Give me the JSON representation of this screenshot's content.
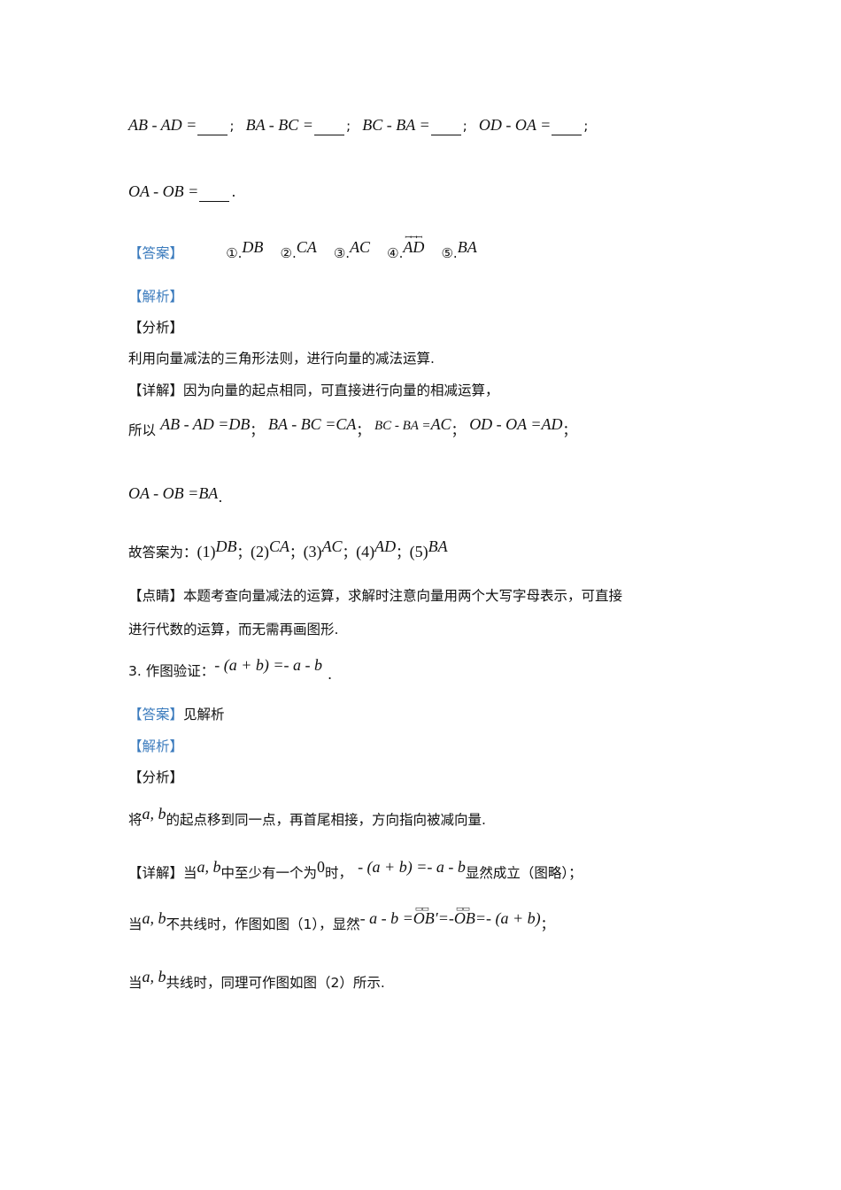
{
  "exercise_line1": [
    {
      "expr": "AB - AD =",
      "end": ";"
    },
    {
      "expr": "BA - BC =",
      "end": ";"
    },
    {
      "expr": "BC - BA =",
      "end": ";"
    },
    {
      "expr": "OD - OA =",
      "end": ";"
    }
  ],
  "exercise_line2": {
    "expr": "OA - OB =",
    "end": "."
  },
  "answer": {
    "tag": "【答案】",
    "items": [
      {
        "num": "①.",
        "val": "DB"
      },
      {
        "num": "②.",
        "val": "CA"
      },
      {
        "num": "③.",
        "val": "AC"
      },
      {
        "num": "④.",
        "val": "AD",
        "overline_mark": "ꟷ"
      },
      {
        "num": "⑤.",
        "val": "BA"
      }
    ]
  },
  "analysis_tag": "【解析】",
  "fenxi_tag": "【分析】",
  "fenxi_text": "利用向量减法的三角形法则，进行向量的减法运算.",
  "detail": {
    "tag": "【详解】",
    "text": "因为向量的起点相同，可直接进行向量的相减运算，",
    "prefix": "所以",
    "eqs": [
      {
        "lhs": "AB - AD =",
        "rhs": "DB",
        "end": "；"
      },
      {
        "lhs": "BA - BC =",
        "rhs": "CA",
        "end": "；"
      },
      {
        "lhs": "BC - BA =",
        "rhs": "AC",
        "end": "；"
      },
      {
        "lhs": "OD - OA =",
        "rhs": "AD",
        "end": "；"
      }
    ],
    "eq5": {
      "lhs": "OA - OB =",
      "rhs": "BA",
      "end": "."
    }
  },
  "summary": {
    "prefix": "故答案为：",
    "items": [
      {
        "num": "(1)",
        "val": "DB",
        "end": "；"
      },
      {
        "num": "(2)",
        "val": "CA",
        "end": "；"
      },
      {
        "num": "(3)",
        "val": "AC",
        "end": "；"
      },
      {
        "num": "(4)",
        "val": "AD",
        "end": "；"
      },
      {
        "num": "(5)",
        "val": "BA",
        "end": ""
      }
    ]
  },
  "comment": {
    "tag": "【点睛】",
    "line1": "本题考查向量减法的运算，求解时注意向量用两个大写字母表示，可直接",
    "line2": "进行代数的运算，而无需再画图形."
  },
  "q3": {
    "label": "3. 作图验证：",
    "expr": "- (a + b) =- a - b",
    "end": ".",
    "answer_tag": "【答案】",
    "answer_text": "见解析",
    "analysis_tag": "【解析】",
    "fenxi_tag": "【分析】",
    "fenxi_pre": "将",
    "ab": "a, b",
    "fenxi_post": "的起点移到同一点，再首尾相接，方向指向被减向量.",
    "detail_tag": "【详解】",
    "detail1_pre": "当",
    "detail1_mid": "中至少有一个为",
    "zero": "0",
    "detail1_mid2": "时，",
    "detail1_expr": "- (a + b) =- a - b",
    "detail1_post": "显然成立（图略）；",
    "detail2_pre": "当",
    "detail2_mid": "不共线时，作图如图（1），显然",
    "detail2_expr_a": "- a - b =",
    "detail2_ob1": "OB′",
    "detail2_expr_b": "=-",
    "detail2_ob2": "OB",
    "detail2_expr_c": "=- (a + b)",
    "detail2_end": "；",
    "detail3_pre": "当",
    "detail3_post": "共线时，同理可作图如图（2）所示."
  }
}
